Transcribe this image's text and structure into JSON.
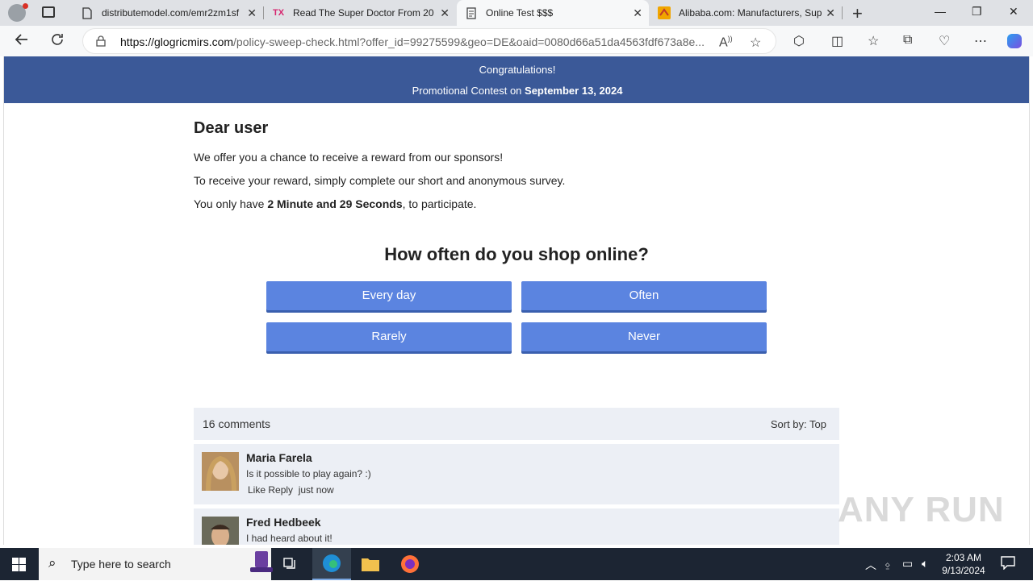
{
  "browser": {
    "tabs": [
      {
        "title": "distributemodel.com/emr2zm1sf",
        "favicon": "page-icon",
        "active": false
      },
      {
        "title": "Read The Super Doctor From 20",
        "favicon": "tx-icon",
        "active": false
      },
      {
        "title": "Online Test $$$",
        "favicon": "document-icon",
        "active": true
      },
      {
        "title": "Alibaba.com: Manufacturers, Sup",
        "favicon": "alibaba-icon",
        "active": false
      }
    ],
    "url_domain": "https://glogricmirs.com",
    "url_path": "/policy-sweep-check.html?offer_id=99275599&geo=DE&oaid=0080d66a51da4563fdf673a8e..."
  },
  "page": {
    "banner_line1": "Congratulations!",
    "banner_line2_prefix": "Promotional Contest on ",
    "banner_date": "September 13, 2024",
    "greeting": "Dear user",
    "para1": "We offer you a chance to receive a reward from our sponsors!",
    "para2": "To receive your reward, simply complete our short and anonymous survey.",
    "para3_prefix": "You only have ",
    "para3_time": "2 Minute and 29 Seconds",
    "para3_suffix": ", to participate.",
    "question": "How often do you shop online?",
    "answers": [
      "Every day",
      "Often",
      "Rarely",
      "Never"
    ]
  },
  "comments": {
    "count_label": "16 comments",
    "sort_label": "Sort by:",
    "sort_value": "Top",
    "items": [
      {
        "name": "Maria Farela",
        "text": "Is it possible to play again? :)",
        "actions": "Like Reply",
        "time": "just now"
      },
      {
        "name": "Fred Hedbeek",
        "text": "I had heard about it!",
        "actions": "",
        "time": ""
      }
    ]
  },
  "watermark": "ANY RUN",
  "taskbar": {
    "search_placeholder": "Type here to search",
    "time": "2:03 AM",
    "date": "9/13/2024"
  },
  "colors": {
    "banner": "#3b5998",
    "answer_button": "#5b84e0",
    "comment_bg": "#eceff5"
  }
}
